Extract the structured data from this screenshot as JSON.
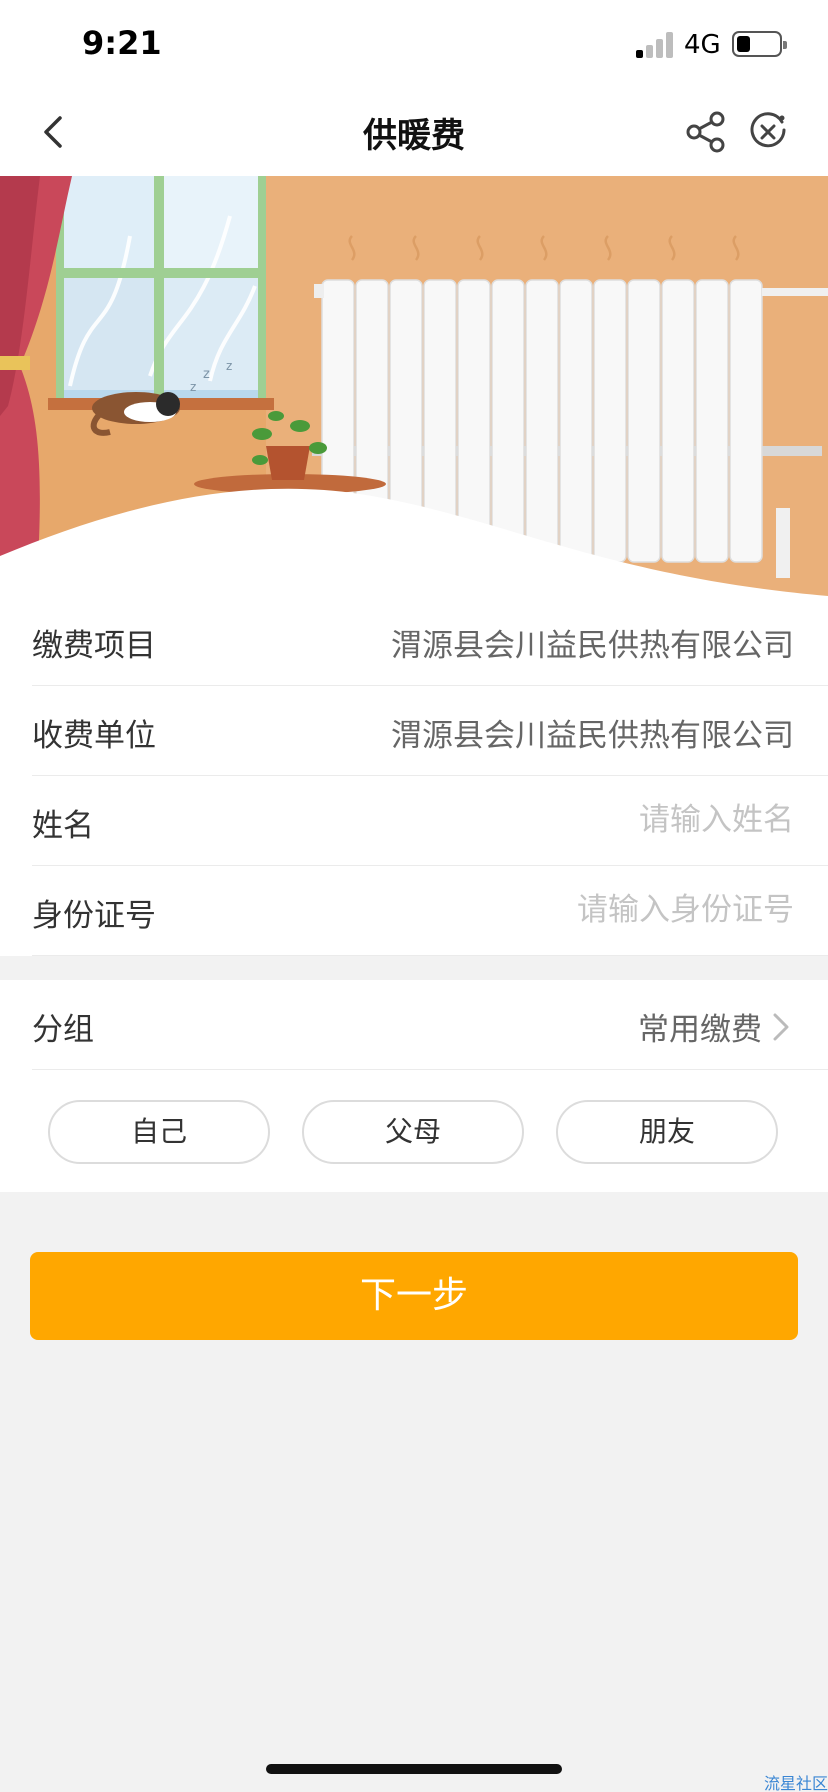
{
  "status_bar": {
    "time": "9:21",
    "network": "4G",
    "battery_level": 0.25
  },
  "nav": {
    "title": "供暖费",
    "back_icon": "chevron-left-icon",
    "share_icon": "share-icon",
    "close_icon": "close-circle-icon"
  },
  "banner": {
    "scene": "winter window, sleeping cat, potted plant on table, radiator with rising heat"
  },
  "form": {
    "rows": [
      {
        "label": "缴费项目",
        "value": "渭源县会川益民供热有限公司"
      },
      {
        "label": "收费单位",
        "value": "渭源县会川益民供热有限公司"
      },
      {
        "label": "姓名",
        "placeholder": "请输入姓名",
        "value": ""
      },
      {
        "label": "身份证号",
        "placeholder": "请输入身份证号",
        "value": ""
      }
    ]
  },
  "group": {
    "label": "分组",
    "selected": "常用缴费",
    "options": [
      "自己",
      "父母",
      "朋友"
    ]
  },
  "actions": {
    "next_label": "下一步"
  },
  "watermark": "流星社区",
  "colors": {
    "accent": "#ffa700",
    "placeholder": "#c4c4c4",
    "background": "#f2f2f2"
  }
}
